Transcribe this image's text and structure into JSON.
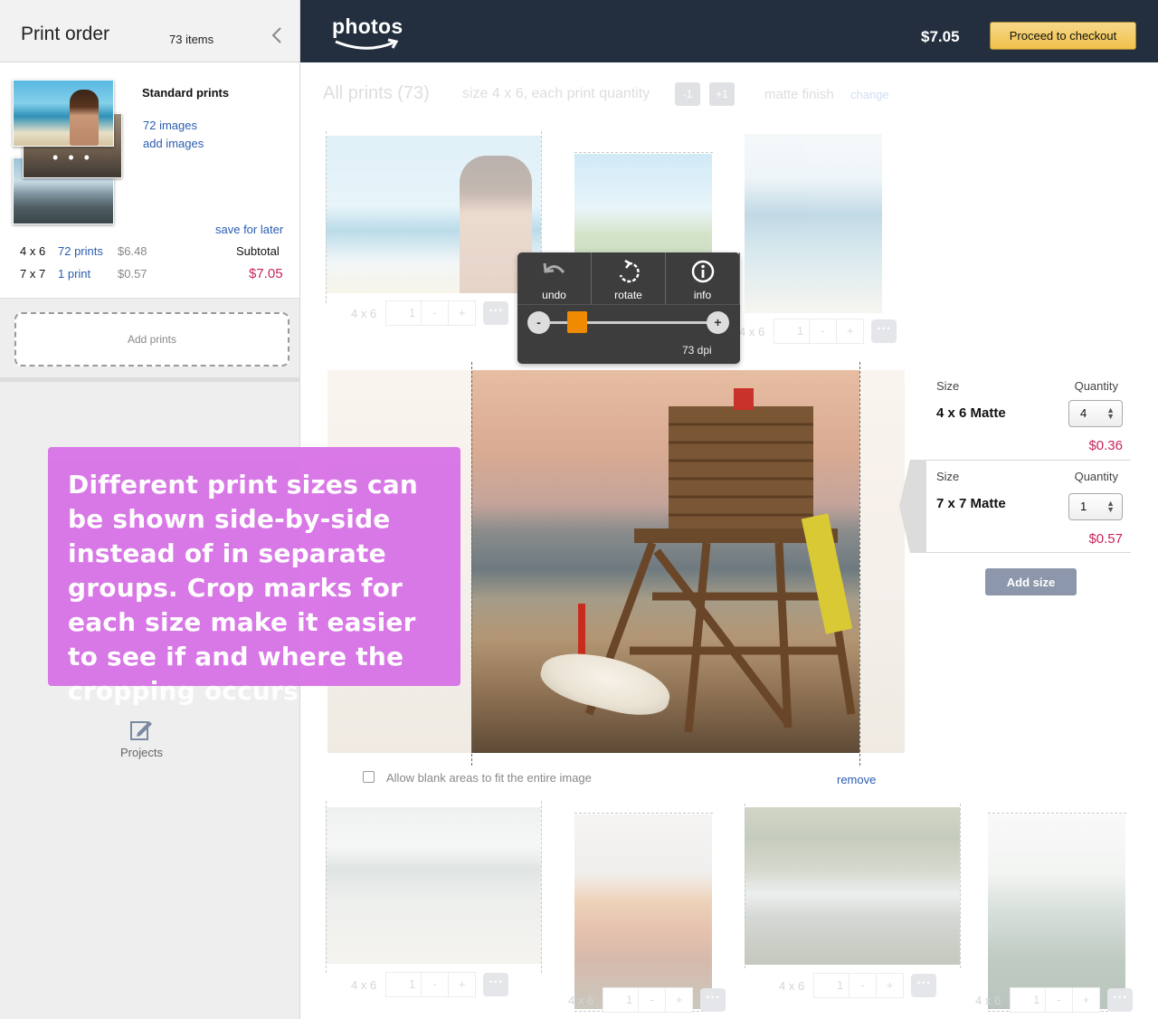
{
  "sidebar": {
    "title": "Print order",
    "item_count": "73 items",
    "group_label": "Standard prints",
    "images_link": "72 images",
    "add_images_link": "add images",
    "thumb_more": "• • •",
    "save_for_later": "save for later",
    "rows": [
      {
        "size": "4 x 6",
        "count": "72 prints",
        "price": "$6.48"
      },
      {
        "size": "7 x 7",
        "count": "1 print",
        "price": "$0.57"
      }
    ],
    "subtotal_label": "Subtotal",
    "subtotal_value": "$7.05",
    "add_prints": "Add prints",
    "projects_label": "Projects"
  },
  "topbar": {
    "logo": "photos",
    "total": "$7.05",
    "checkout_label": "Proceed to checkout"
  },
  "header": {
    "all_prints": "All prints (73)",
    "size_text": "size 4 x 6,  each print quantity",
    "minus_label": "-1",
    "plus_label": "+1",
    "finish_text": "matte finish",
    "change_link": "change"
  },
  "quantity_rows": [
    {
      "size": "4 x 6",
      "qty": "1"
    },
    {
      "size": "4 x 6",
      "qty": "1"
    },
    {
      "size": "4 x 6",
      "qty": "1"
    },
    {
      "size": "4 x 6",
      "qty": "1"
    },
    {
      "size": "4 x 6",
      "qty": "1"
    },
    {
      "size": "4 x 6",
      "qty": "1"
    }
  ],
  "stepper": {
    "minus": "-",
    "plus": "+",
    "more": "···"
  },
  "toolbar": {
    "undo": "undo",
    "rotate": "rotate",
    "info": "info",
    "zoom_minus": "-",
    "zoom_plus": "+",
    "zoom_level": 0.13,
    "dpi": "73 dpi"
  },
  "editor": {
    "allow_blank": "Allow blank areas to fit the entire image",
    "remove": "remove"
  },
  "size_panel": {
    "size_header": "Size",
    "quantity_header": "Quantity",
    "sizes": [
      {
        "name": "4 x 6  Matte",
        "qty": "4",
        "price": "$0.36"
      },
      {
        "name": "7 x 7  Matte",
        "qty": "1",
        "price": "$0.57"
      }
    ],
    "add_size": "Add size"
  },
  "callout": {
    "text": "Different print sizes can be shown side-by-side instead of in separate groups. Crop marks for each size make it easier to see if and where the cropping occurs."
  },
  "colors": {
    "topbar": "#232f3e",
    "checkout": "#f0c14b",
    "price": "#c7255e",
    "link": "#2a5db0",
    "callout": "#d874e6",
    "zoom_handle": "#f08a00"
  }
}
